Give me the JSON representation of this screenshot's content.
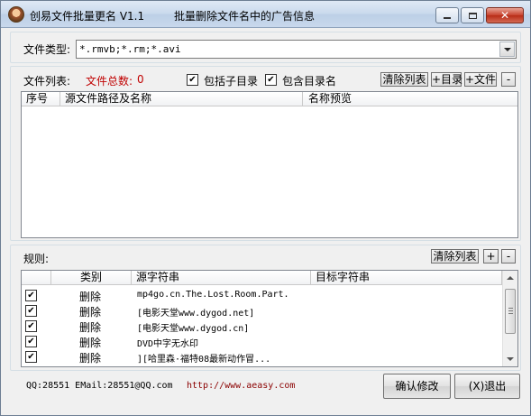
{
  "window": {
    "title": "创易文件批量更名 V1.1",
    "subtitle": "批量删除文件名中的广告信息"
  },
  "file_type": {
    "label": "文件类型:",
    "value": "*.rmvb;*.rm;*.avi"
  },
  "file_list": {
    "label": "文件列表:",
    "total_label": "文件总数:",
    "total_count": "0",
    "include_subdirs_label": "包括子目录",
    "include_subdirs_checked": true,
    "include_dirname_label": "包含目录名",
    "include_dirname_checked": true,
    "clear_label": "清除列表",
    "add_dir_label": "+目录",
    "add_file_label": "+文件",
    "remove_label": "-",
    "columns": [
      "序号",
      "源文件路径及名称",
      "名称预览"
    ],
    "rows": []
  },
  "rules": {
    "label": "规则:",
    "clear_label": "清除列表",
    "add_label": "+",
    "remove_label": "-",
    "columns": [
      "",
      "类别",
      "源字符串",
      "目标字符串"
    ],
    "rows": [
      {
        "checked": true,
        "type": "删除",
        "source": "mp4go.cn.The.Lost.Room.Part.",
        "target": ""
      },
      {
        "checked": true,
        "type": "删除",
        "source": "[电影天堂www.dygod.net]",
        "target": ""
      },
      {
        "checked": true,
        "type": "删除",
        "source": "[电影天堂www.dygod.cn]",
        "target": ""
      },
      {
        "checked": true,
        "type": "删除",
        "source": "DVD中字无水印",
        "target": ""
      },
      {
        "checked": true,
        "type": "删除",
        "source": " ][哈里森·福特08最新动作冒...",
        "target": ""
      }
    ]
  },
  "footer": {
    "contact": "QQ:28551 EMail:28551@QQ.com",
    "url": "http://www.aeasy.com",
    "confirm_label": "确认修改",
    "exit_label": "(X)退出"
  }
}
